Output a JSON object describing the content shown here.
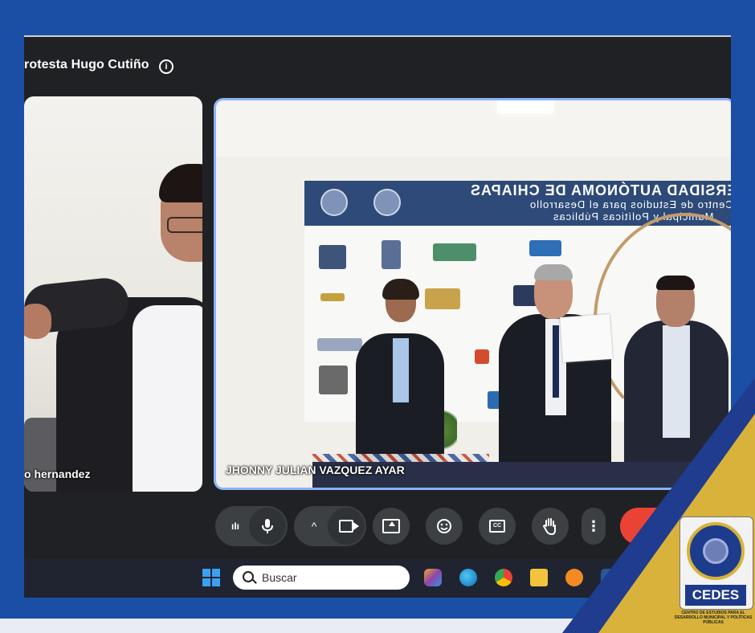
{
  "meeting": {
    "title": "rotesta Hugo Cutiño",
    "info_icon": "info-icon"
  },
  "participants": [
    {
      "name": "o hernandez"
    },
    {
      "name": "JHONNY JULIAN VAZQUEZ AYAR"
    }
  ],
  "banner": {
    "title": "ERSIDAD AUTÓNOMA DE CHIAPAS",
    "line1": "Centro de Estudios para el Desarrollo",
    "line2": "Municipal y Políticas Públicas"
  },
  "toolbar": {
    "buttons": [
      "mic-levels",
      "microphone",
      "more-audio",
      "camera",
      "present-screen",
      "emoji",
      "captions",
      "raise-hand",
      "more-options",
      "end-call"
    ],
    "captions_label": "CC"
  },
  "taskbar": {
    "search_placeholder": "Buscar"
  },
  "cedes": {
    "name": "CEDES",
    "subtitle": "CENTRO DE ESTUDIOS PARA EL DESARROLLO MUNICIPAL Y POLÍTICAS PÚBLICAS"
  },
  "colors": {
    "frame_blue": "#1b4fa6",
    "meet_bg": "#202124",
    "active_border": "#8ab4f8",
    "end_call": "#ea4335",
    "cedes_gold": "#d8b23a",
    "cedes_navy": "#1d3a8a"
  }
}
